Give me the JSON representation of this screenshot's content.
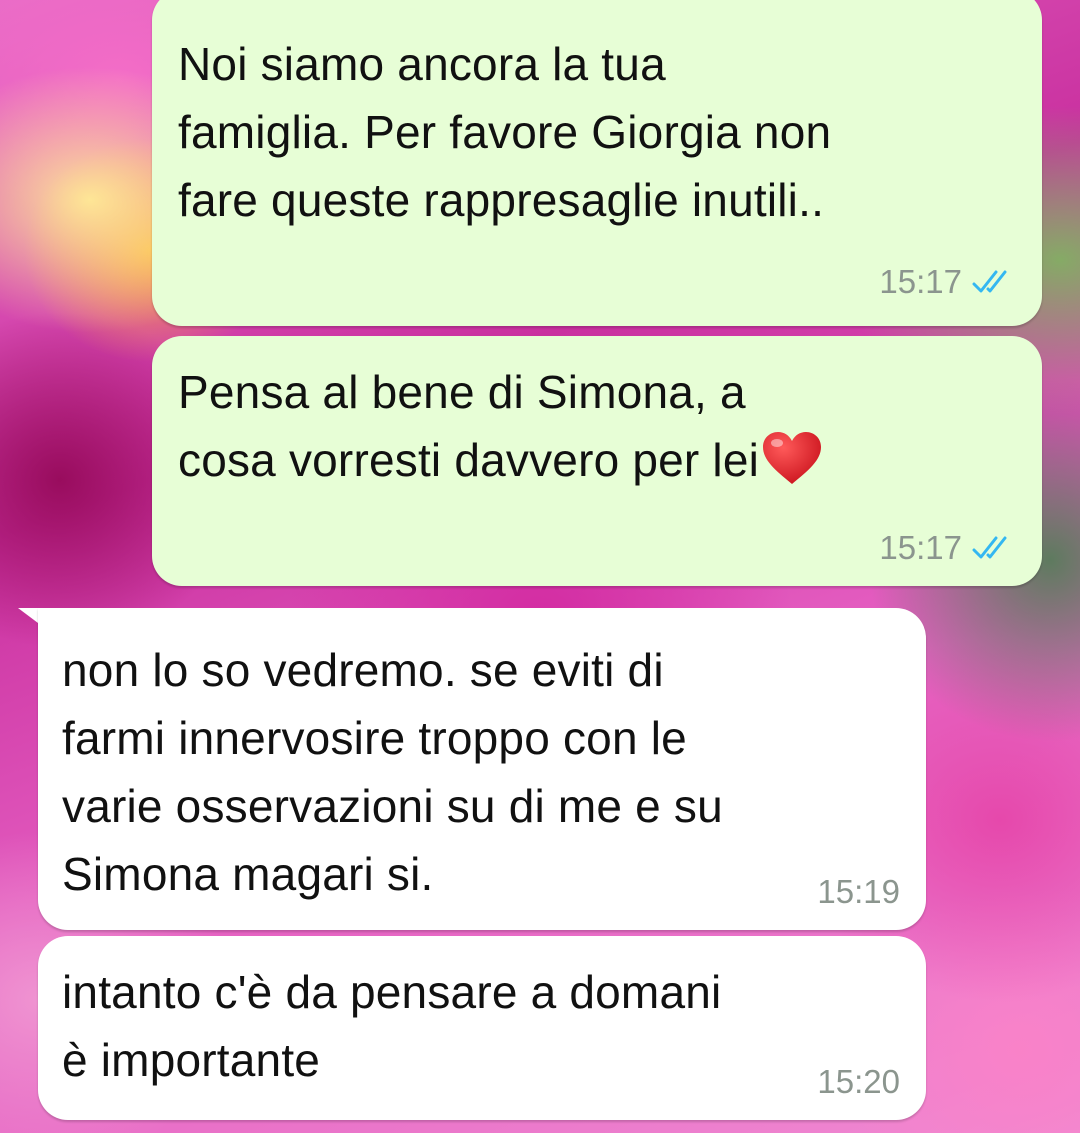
{
  "messages": [
    {
      "direction": "outgoing",
      "text": "Noi siamo ancora la tua\nfamiglia. Per favore Giorgia non\nfare queste rappresaglie inutili..",
      "time": "15:17",
      "status": "read-double-check-icon"
    },
    {
      "direction": "outgoing",
      "text": "Pensa al bene di Simona, a\ncosa vorresti davvero per lei",
      "emoji": "red-heart-icon",
      "time": "15:17",
      "status": "read-double-check-icon"
    },
    {
      "direction": "incoming",
      "text": "non lo so vedremo. se eviti di\nfarmi innervosire troppo con le\nvarie osservazioni su di me e su\nSimona magari si.",
      "time": "15:19"
    },
    {
      "direction": "incoming",
      "text": "intanto c'è da pensare a domani\nè importante",
      "time": "15:20"
    }
  ],
  "colors": {
    "outgoing_bubble": "#e7fed6",
    "incoming_bubble": "#ffffff",
    "read_ticks": "#34b7f1",
    "timestamp": "#8b958e"
  }
}
